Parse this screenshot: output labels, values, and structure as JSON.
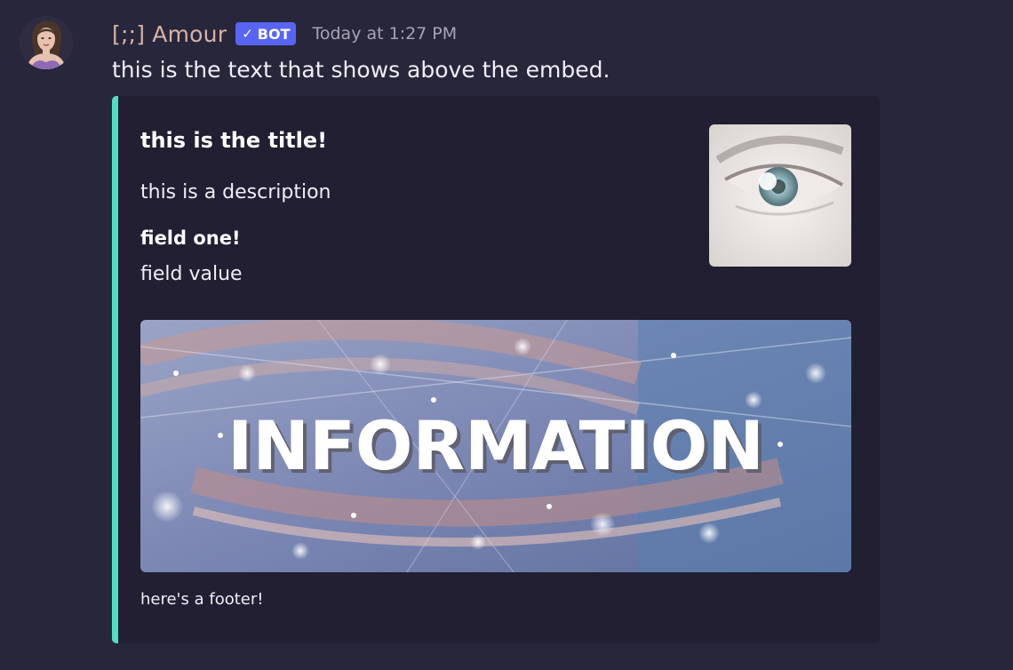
{
  "message": {
    "username": "[;;] Amour",
    "bot_badge": {
      "check": "✓",
      "label": "BOT"
    },
    "timestamp": "Today at 1:27 PM",
    "content": "this is the text that shows above the embed."
  },
  "embed": {
    "accent_color": "#4fdfc3",
    "title": "this is the title!",
    "description": "this is a description",
    "fields": [
      {
        "name": "field one!",
        "value": "field value"
      }
    ],
    "image_text": "INFORMATION",
    "footer": "here's a footer!"
  }
}
